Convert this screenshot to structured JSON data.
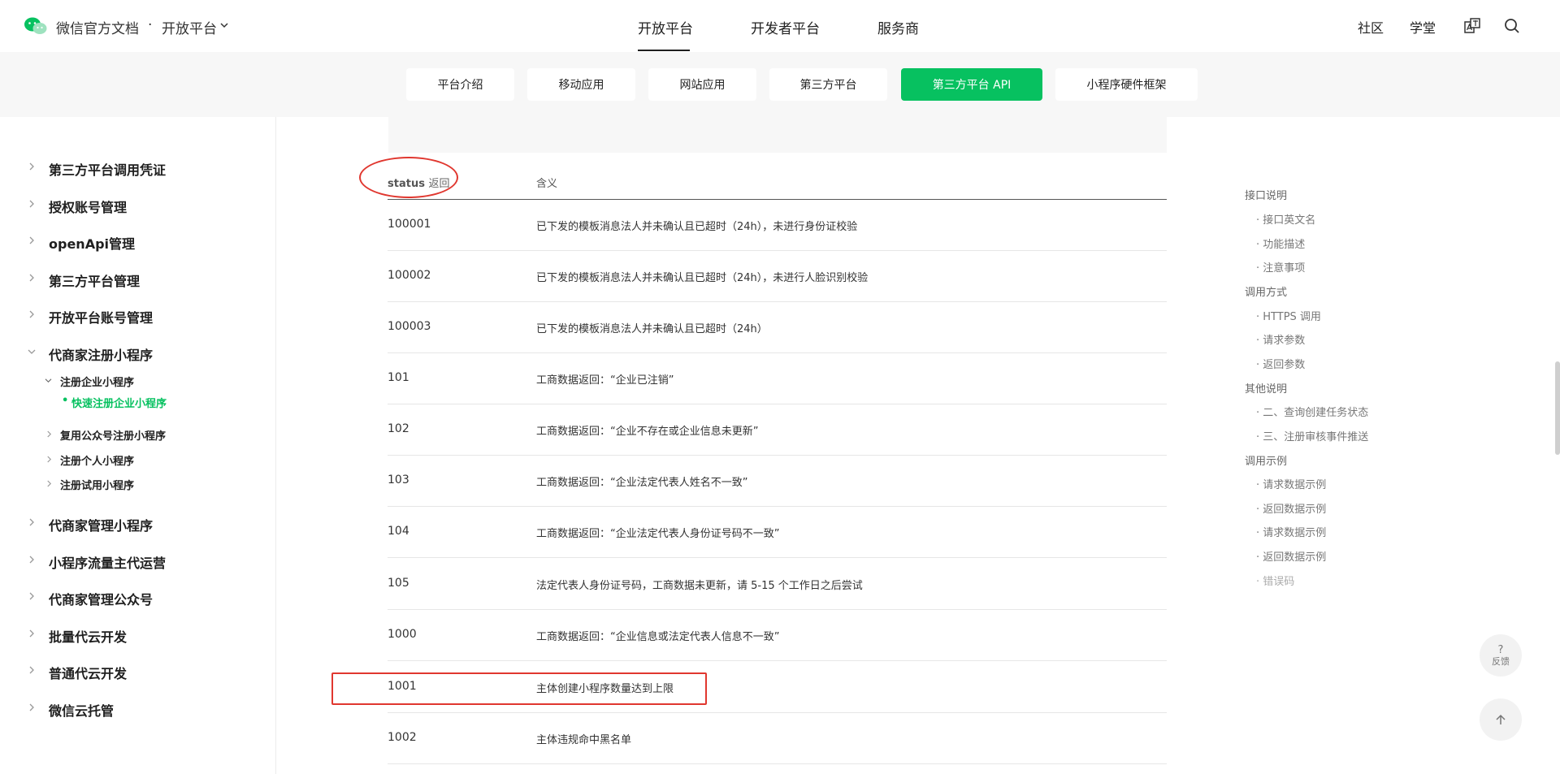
{
  "header": {
    "brand": "微信官方文档",
    "dot": "·",
    "platform": "开放平台",
    "nav": [
      "开放平台",
      "开发者平台",
      "服务商"
    ],
    "right_links": [
      "社区",
      "学堂"
    ],
    "icons": [
      "translate-icon",
      "search-icon"
    ]
  },
  "subnav": {
    "tabs": [
      "平台介绍",
      "移动应用",
      "网站应用",
      "第三方平台",
      "第三方平台 API",
      "小程序硬件框架"
    ],
    "active": "第三方平台 API"
  },
  "sidebar": {
    "items": [
      "第三方平台调用凭证",
      "授权账号管理",
      "openApi管理",
      "第三方平台管理",
      "开放平台账号管理",
      "代商家注册小程序",
      "代商家管理小程序",
      "小程序流量主代运营",
      "代商家管理公众号",
      "批量代云开发",
      "普通代云开发",
      "微信云托管"
    ],
    "sub_items": {
      "group": "注册企业小程序",
      "active": "快速注册企业小程序",
      "others": [
        "复用公众号注册小程序",
        "注册个人小程序",
        "注册试用小程序"
      ]
    }
  },
  "table": {
    "header_code_bold": "status",
    "header_code_light": "返回",
    "header_meaning": "含义",
    "rows": [
      {
        "code": "100001",
        "meaning": "已下发的模板消息法人并未确认且已超时（24h），未进行身份证校验"
      },
      {
        "code": "100002",
        "meaning": "已下发的模板消息法人并未确认且已超时（24h），未进行人脸识别校验"
      },
      {
        "code": "100003",
        "meaning": "已下发的模板消息法人并未确认且已超时（24h）"
      },
      {
        "code": "101",
        "meaning": "工商数据返回：“企业已注销”"
      },
      {
        "code": "102",
        "meaning": "工商数据返回：“企业不存在或企业信息未更新”"
      },
      {
        "code": "103",
        "meaning": "工商数据返回：“企业法定代表人姓名不一致”"
      },
      {
        "code": "104",
        "meaning": "工商数据返回：“企业法定代表人身份证号码不一致”"
      },
      {
        "code": "105",
        "meaning": "法定代表人身份证号码，工商数据未更新，请 5-15 个工作日之后尝试"
      },
      {
        "code": "1000",
        "meaning": "工商数据返回：“企业信息或法定代表人信息不一致”"
      },
      {
        "code": "1001",
        "meaning": "主体创建小程序数量达到上限"
      },
      {
        "code": "1002",
        "meaning": "主体违规命中黑名单"
      }
    ]
  },
  "toc": {
    "groups": [
      {
        "title": "接口说明",
        "items": [
          "· 接口英文名",
          "· 功能描述",
          "· 注意事项"
        ]
      },
      {
        "title": "调用方式",
        "items": [
          "· HTTPS 调用",
          "· 请求参数",
          "· 返回参数"
        ]
      },
      {
        "title": "其他说明",
        "items": [
          "· 二、查询创建任务状态",
          "· 三、注册审核事件推送"
        ]
      },
      {
        "title": "调用示例",
        "items": [
          "· 请求数据示例",
          "· 返回数据示例",
          "· 请求数据示例",
          "· 返回数据示例",
          "· 错误码"
        ]
      }
    ]
  },
  "float": {
    "feedback_q": "?",
    "feedback_label": "反馈"
  },
  "colors": {
    "accent": "#07c160",
    "annotation": "#e0372f"
  }
}
